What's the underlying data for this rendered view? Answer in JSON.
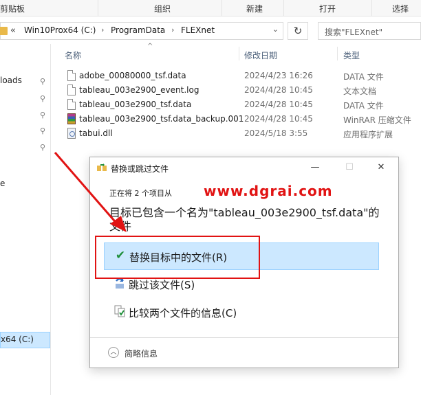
{
  "ribbon": {
    "groups": [
      "剪贴板",
      "组织",
      "新建",
      "打开",
      "选择"
    ]
  },
  "address": {
    "back_glyph": "«",
    "crumbs": [
      "Win10Prox64 (C:)",
      "ProgramData",
      "FLEXnet"
    ],
    "search_placeholder": "搜索\"FLEXnet\""
  },
  "nav": {
    "items": [
      "loads",
      "e",
      "x64 (C:)"
    ],
    "pin_icon": "pin-icon"
  },
  "columns": {
    "name": "名称",
    "date": "修改日期",
    "type": "类型"
  },
  "files": [
    {
      "name": "adobe_00080000_tsf.data",
      "date": "2024/4/23 16:26",
      "type": "DATA 文件",
      "icon": "data-file-icon"
    },
    {
      "name": "tableau_003e2900_event.log",
      "date": "2024/4/28 10:45",
      "type": "文本文档",
      "icon": "text-file-icon"
    },
    {
      "name": "tableau_003e2900_tsf.data",
      "date": "2024/4/28 10:45",
      "type": "DATA 文件",
      "icon": "data-file-icon"
    },
    {
      "name": "tableau_003e2900_tsf.data_backup.001",
      "date": "2024/4/28 10:45",
      "type": "WinRAR 压缩文件",
      "icon": "winrar-icon"
    },
    {
      "name": "tabui.dll",
      "date": "2024/5/18 3:55",
      "type": "应用程序扩展",
      "icon": "dll-icon"
    }
  ],
  "dialog": {
    "title": "替换或跳过文件",
    "progress": "正在将 2 个项目从",
    "watermark": "www.dgrai.com",
    "dest_message": "目标已包含一个名为\"tableau_003e2900_tsf.data\"的文件",
    "options": [
      {
        "label": "替换目标中的文件(R)",
        "icon": "check-icon",
        "selected": true
      },
      {
        "label": "跳过该文件(S)",
        "icon": "skip-icon",
        "selected": false
      },
      {
        "label": "比较两个文件的信息(C)",
        "icon": "compare-icon",
        "selected": false
      }
    ],
    "footer": "简略信息",
    "controls": {
      "minimize": "—",
      "maximize": "☐",
      "close": "✕"
    }
  },
  "colors": {
    "accent_selection": "#cce8ff",
    "annotation_red": "#e11313",
    "check_green": "#1f8f3a"
  }
}
